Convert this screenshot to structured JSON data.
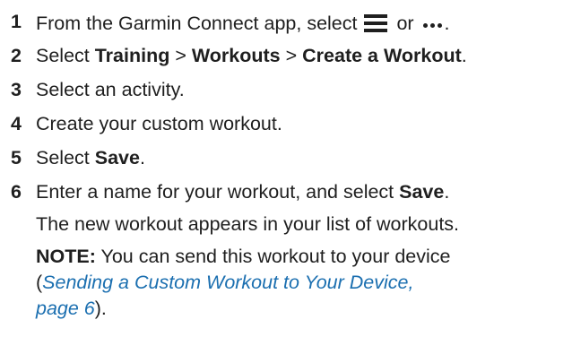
{
  "steps": [
    {
      "number": "1",
      "pre": "From the Garmin Connect app, select ",
      "menu_icon": "hamburger-menu-icon",
      "or": " or ",
      "more_icon": "more-dots-icon",
      "end": "."
    },
    {
      "number": "2",
      "pre": "Select ",
      "b1": "Training",
      "sep1": " > ",
      "b2": "Workouts",
      "sep2": " > ",
      "b3": "Create a Workout",
      "end": "."
    },
    {
      "number": "3",
      "text": "Select an activity."
    },
    {
      "number": "4",
      "text": "Create your custom workout."
    },
    {
      "number": "5",
      "pre": "Select ",
      "b1": "Save",
      "end": "."
    },
    {
      "number": "6",
      "pre": "Enter a name for your workout, and select ",
      "b1": "Save",
      "end": "."
    }
  ],
  "result_text": "The new workout appears in your list of workouts.",
  "note": {
    "label": "NOTE:",
    "line1": " You can send this workout to your device",
    "open_paren": "(",
    "link_line1": "Sending a Custom Workout to Your Device,",
    "link_line2": "page 6",
    "close": ")."
  },
  "colors": {
    "text": "#1f1f1f",
    "link": "#1b6fb0"
  }
}
